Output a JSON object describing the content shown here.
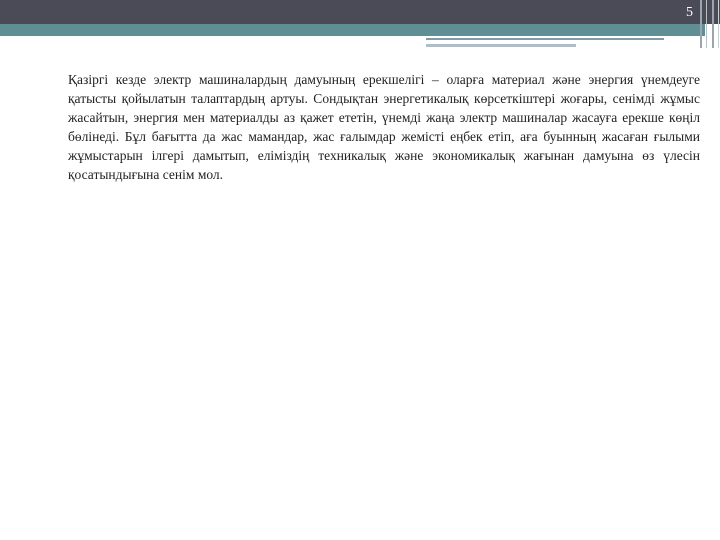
{
  "page": {
    "number": "5"
  },
  "content": {
    "paragraph": "Қазіргі кезде электр машиналардың дамуының ерекшелігі – оларға материал және энергия үнемдеуге қатысты қойылатын талаптардың артуы. Сондықтан энергетикалық көрсеткіштері жоғары, сенімді жұмыс жасайтын, энергия мен материалды аз қажет ететін, үнемді жаңа электр машиналар жасауға ерекше көңіл бөлінеді.   Бұл бағытта да жас мамандар, жас ғалымдар жемісті еңбек етіп, аға буынның жасаған ғылыми жұмыстарын ілгері дамытып, еліміздің техникалық және экономикалық жағынан дамуына өз үлесін қосатындығына сенім мол."
  },
  "theme": {
    "top_bar_color": "#4b4b57",
    "accent_color": "#5f8f94"
  }
}
